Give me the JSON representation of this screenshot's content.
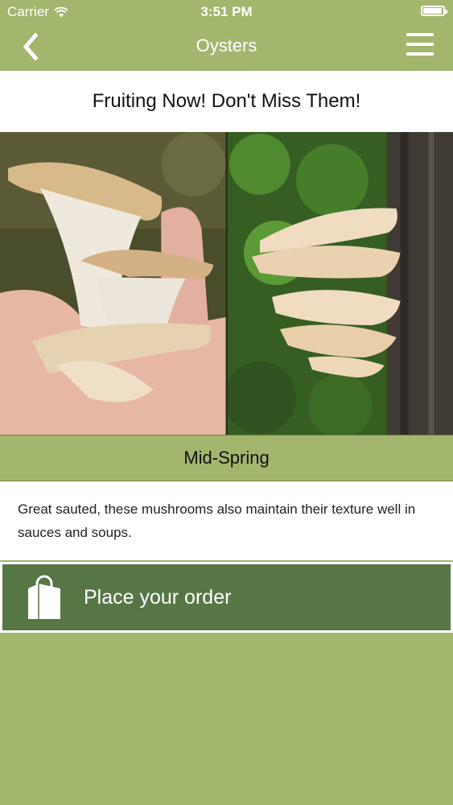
{
  "status_bar": {
    "carrier": "Carrier",
    "time": "3:51 PM",
    "battery_level": 0.95
  },
  "nav": {
    "title": "Oysters",
    "back_icon": "chevron-left-icon",
    "menu_icon": "hamburger-menu-icon"
  },
  "headline": "Fruiting Now! Don't Miss Them!",
  "photos": [
    {
      "name": "oyster-mushroom-in-hand"
    },
    {
      "name": "oyster-mushrooms-on-tree-trunk"
    }
  ],
  "season": "Mid-Spring",
  "description": "Great sauted, these mushrooms also maintain their texture well in sauces and soups.",
  "order_button": {
    "label": "Place your order",
    "icon": "shopping-bag-icon"
  },
  "colors": {
    "accent": "#a2b66e",
    "button": "#577645",
    "text": "#111111"
  }
}
